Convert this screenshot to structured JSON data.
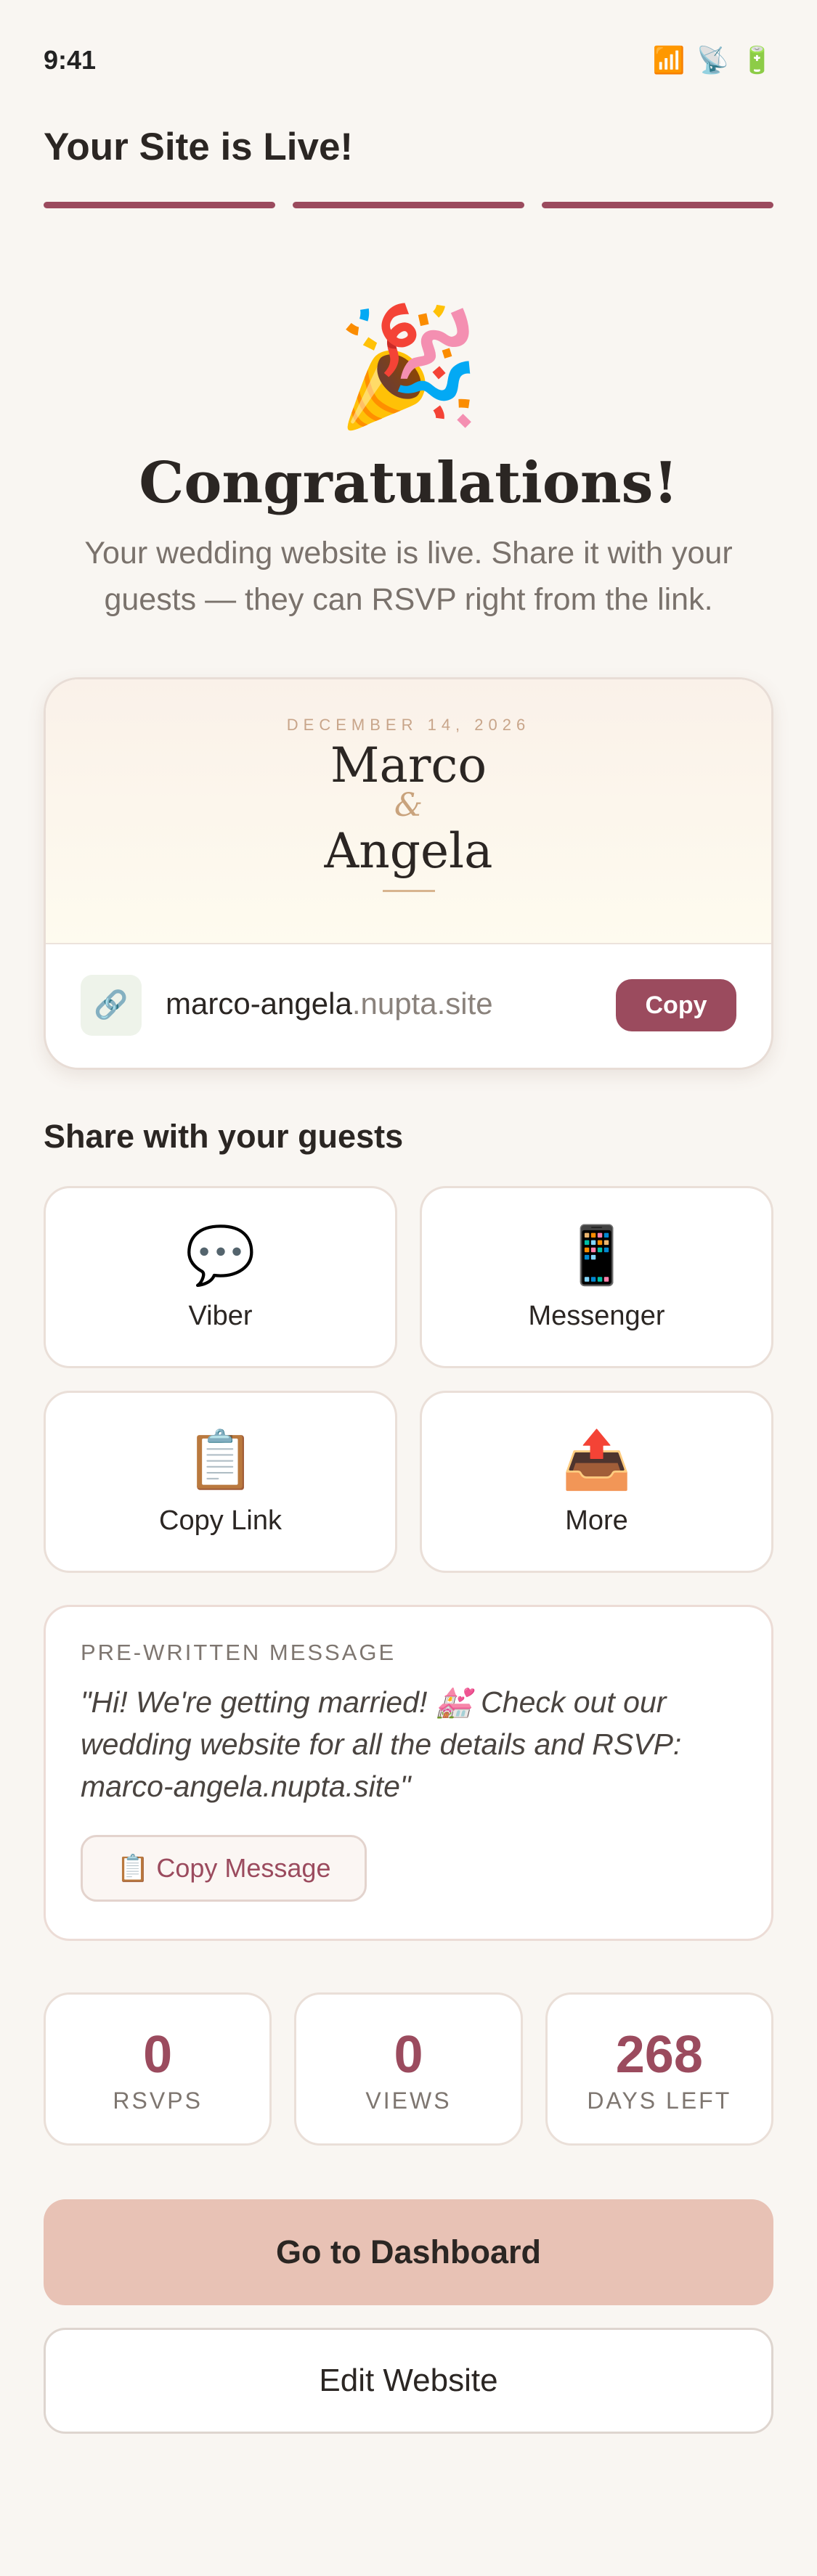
{
  "status_bar": {
    "time": "9:41",
    "icons": [
      {
        "name": "signal-icon",
        "glyph": "📶"
      },
      {
        "name": "satellite-icon",
        "glyph": "📡"
      },
      {
        "name": "battery-icon",
        "glyph": "🔋"
      }
    ]
  },
  "header": {
    "title": "Your Site is Live!",
    "progress_steps": [
      {
        "label": "step-1",
        "complete": true
      },
      {
        "label": "step-2",
        "complete": true
      },
      {
        "label": "step-3",
        "complete": true
      }
    ],
    "accent_color": "#9b4b5e"
  },
  "hero": {
    "icon": "🎉",
    "icon_name": "party-popper-icon",
    "title": "Congratulations!",
    "subtitle": "Your wedding website is live. Share it with your guests — they can RSVP right from the link."
  },
  "site_preview": {
    "date": "DECEMBER 14, 2026",
    "name_one": "Marco",
    "ampersand": "&",
    "name_two": "Angela",
    "link_icon": "🔗",
    "url_main": "marco-angela",
    "url_domain": ".nupta.site",
    "copy_label": "Copy"
  },
  "share": {
    "title": "Share with your guests",
    "options": [
      {
        "icon": "💬",
        "icon_name": "speech-bubble-icon",
        "label": "Viber"
      },
      {
        "icon": "📱",
        "icon_name": "mobile-phone-icon",
        "label": "Messenger"
      },
      {
        "icon": "📋",
        "icon_name": "clipboard-icon",
        "label": "Copy Link"
      },
      {
        "icon": "📤",
        "icon_name": "outbox-tray-icon",
        "label": "More"
      }
    ]
  },
  "message": {
    "heading": "PRE-WRITTEN MESSAGE",
    "text": "\"Hi! We're getting married! 💒 Check out our wedding website for all the details and RSVP: marco-angela.nupta.site\"",
    "button_icon": "📋",
    "button_label": "Copy Message"
  },
  "stats": [
    {
      "value": "0",
      "label": "RSVPS"
    },
    {
      "value": "0",
      "label": "VIEWS"
    },
    {
      "value": "268",
      "label": "DAYS LEFT"
    }
  ],
  "actions": {
    "primary_label": "Go to Dashboard",
    "secondary_label": "Edit Website"
  }
}
